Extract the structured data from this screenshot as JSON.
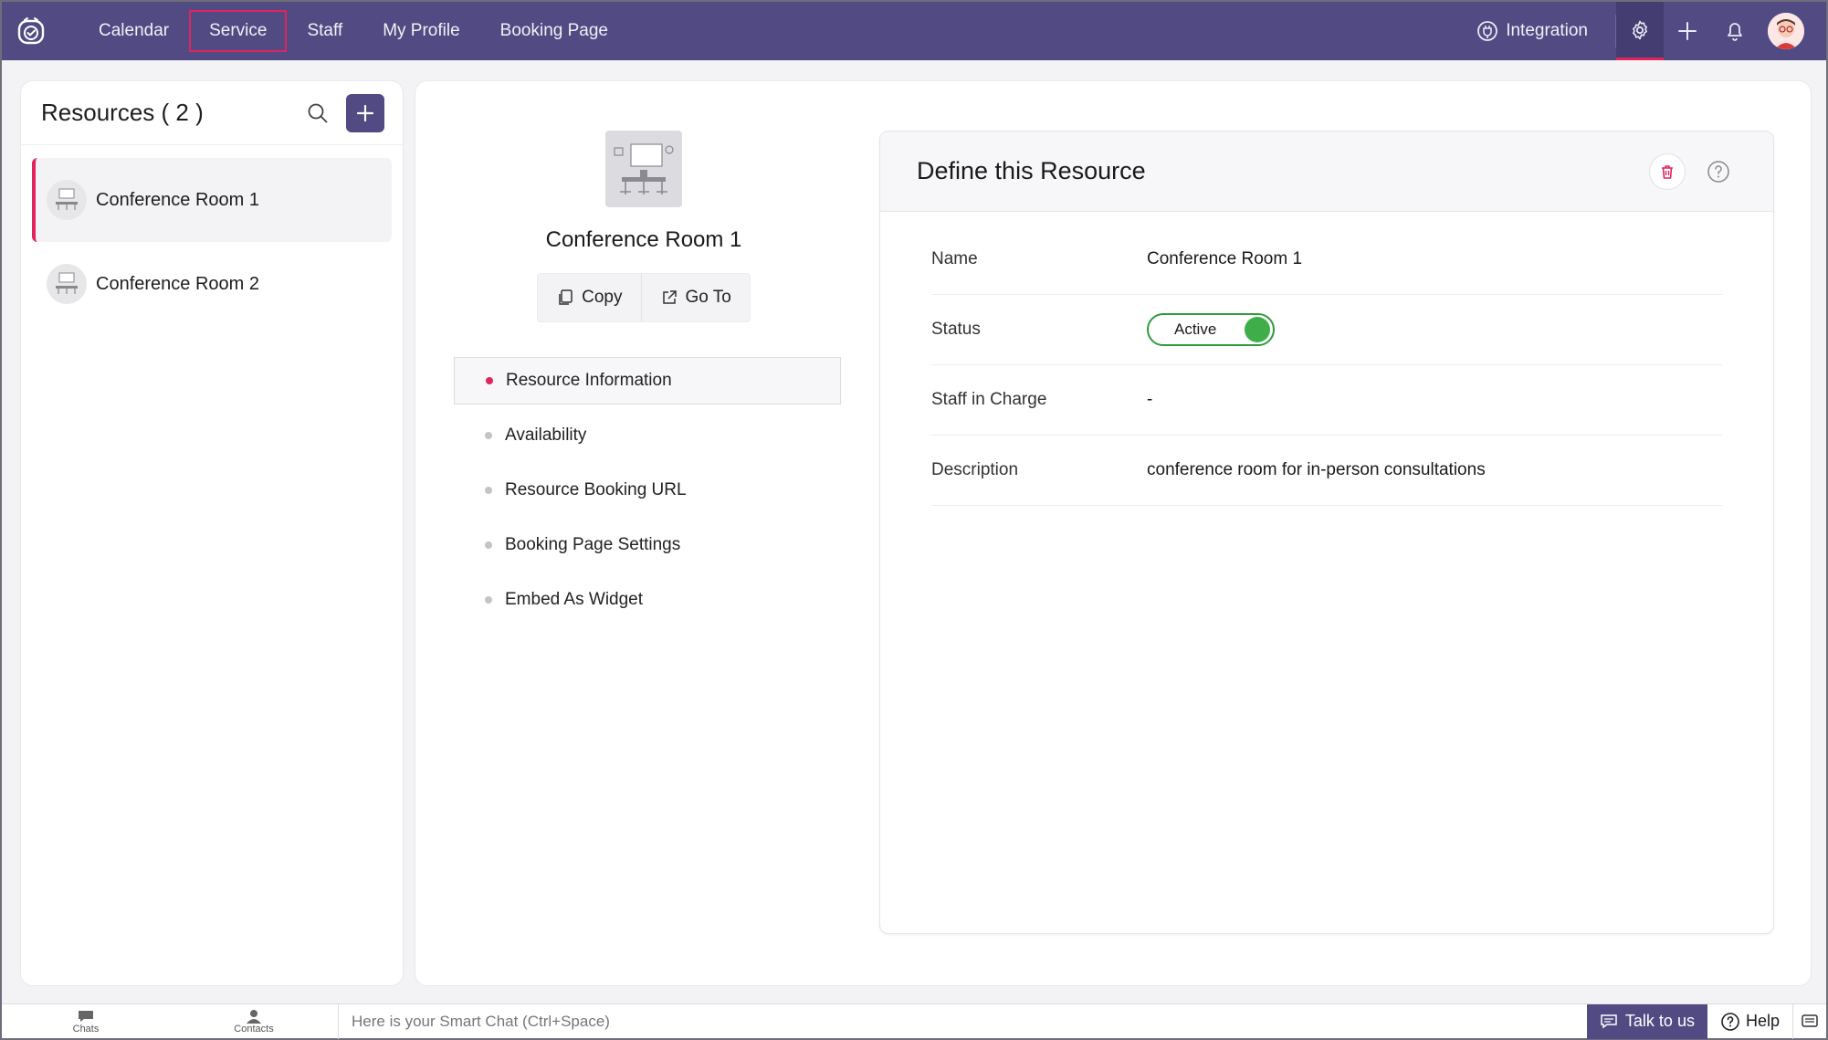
{
  "topbar": {
    "nav": [
      "Calendar",
      "Service",
      "Staff",
      "My Profile",
      "Booking Page"
    ],
    "integration_label": "Integration"
  },
  "resources": {
    "title": "Resources ( 2 )",
    "items": [
      {
        "name": "Conference Room 1"
      },
      {
        "name": "Conference Room 2"
      }
    ]
  },
  "profile": {
    "name": "Conference Room 1",
    "copy_label": "Copy",
    "goto_label": "Go To"
  },
  "side_menu": [
    "Resource Information",
    "Availability",
    "Resource Booking URL",
    "Booking Page Settings",
    "Embed As Widget"
  ],
  "define": {
    "title": "Define this Resource",
    "fields": {
      "name_label": "Name",
      "name_value": "Conference Room 1",
      "status_label": "Status",
      "status_value": "Active",
      "staff_label": "Staff in Charge",
      "staff_value": "-",
      "description_label": "Description",
      "description_value": "conference room for in-person consultations"
    }
  },
  "bottombar": {
    "chats": "Chats",
    "contacts": "Contacts",
    "smart_chat": "Here is your Smart Chat (Ctrl+Space)",
    "talk": "Talk to us",
    "help": "Help"
  },
  "colors": {
    "topbar": "#524a82",
    "accent": "#e0245e",
    "active_green": "#3fae49"
  }
}
